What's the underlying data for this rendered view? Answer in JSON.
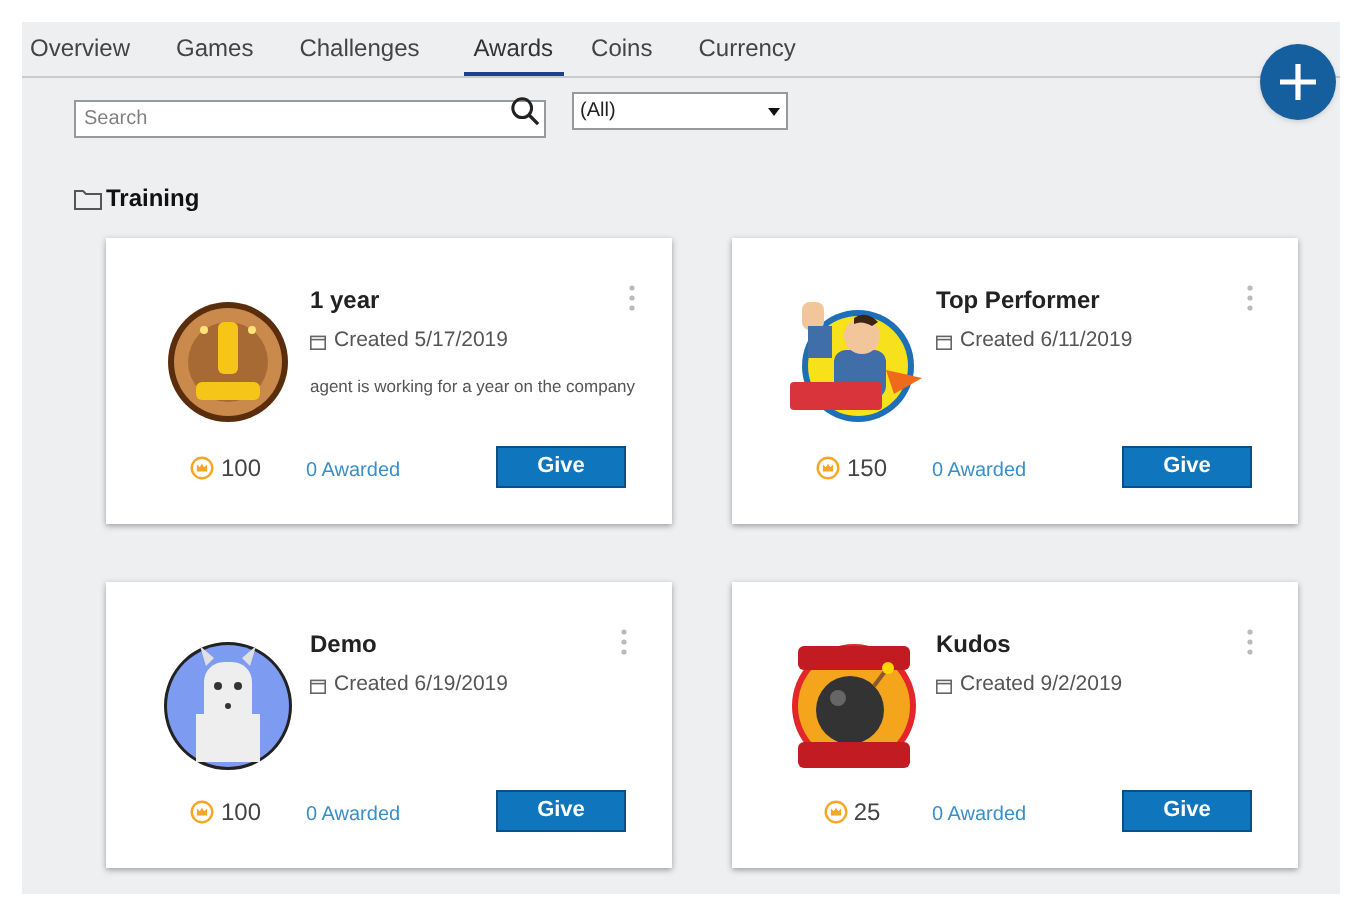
{
  "tabs": [
    {
      "label": "Overview",
      "selected": false
    },
    {
      "label": "Games",
      "selected": false
    },
    {
      "label": "Challenges",
      "selected": false
    },
    {
      "label": "Awards",
      "selected": true
    },
    {
      "label": "Coins",
      "selected": false
    },
    {
      "label": "Currency",
      "selected": false
    }
  ],
  "search": {
    "placeholder": "Search"
  },
  "filter": {
    "value": "(All)"
  },
  "folder": {
    "title": "Training"
  },
  "awards": [
    {
      "title": "1 year",
      "created": "Created 5/17/2019",
      "description": "agent is working for a year on the company",
      "points": "100",
      "awarded": "0 Awarded",
      "button": "Give"
    },
    {
      "title": "Top Performer",
      "created": "Created 6/11/2019",
      "points": "150",
      "awarded": "0 Awarded",
      "button": "Give"
    },
    {
      "title": "Demo",
      "created": "Created 6/19/2019",
      "points": "100",
      "awarded": "0 Awarded",
      "button": "Give"
    },
    {
      "title": "Kudos",
      "created": "Created 9/2/2019",
      "points": "25",
      "awarded": "0 Awarded",
      "button": "Give"
    }
  ]
}
